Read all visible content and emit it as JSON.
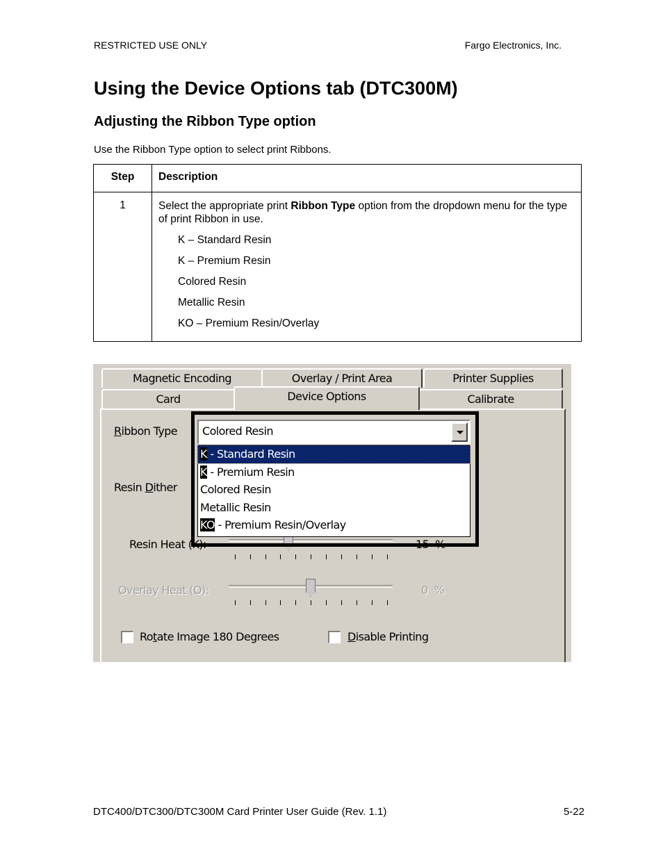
{
  "header": {
    "left": "RESTRICTED USE ONLY",
    "right": "Fargo Electronics, Inc."
  },
  "title": "Using the Device Options tab (DTC300M)",
  "subtitle": "Adjusting the Ribbon Type option",
  "intro": "Use the Ribbon Type option to select print Ribbons.",
  "table": {
    "headers": [
      "Step",
      "Description"
    ],
    "rows": [
      {
        "step": "1",
        "text_before": "Select the appropriate print ",
        "text_bold": "Ribbon Type",
        "text_after": " option from the dropdown menu for the type of print Ribbon in use.",
        "options": [
          "K – Standard Resin",
          "K – Premium Resin",
          "Colored Resin",
          "Metallic Resin",
          "KO – Premium Resin/Overlay"
        ]
      }
    ]
  },
  "dialog": {
    "tabs_back": [
      "Magnetic Encoding",
      "Overlay / Print Area",
      "Printer Supplies"
    ],
    "tabs_front": [
      "Card",
      "Device Options",
      "Calibrate"
    ],
    "active_tab": "Device Options",
    "ribbon_type": {
      "label_hotkey": "R",
      "label_rest": "ibbon Type",
      "value": "Colored Resin",
      "options": [
        {
          "hotkey": "K",
          "rest": " - Standard Resin",
          "selected": true
        },
        {
          "hotkey": "K",
          "rest": " - Premium Resin",
          "selected": false
        },
        {
          "hotkey": "",
          "rest": "Colored Resin",
          "selected": false
        },
        {
          "hotkey": "",
          "rest": "Metallic Resin",
          "selected": false
        },
        {
          "hotkey": "KO",
          "rest": " - Premium Resin/Overlay",
          "selected": false
        }
      ]
    },
    "resin_dither": {
      "label_pre": "Resin ",
      "label_hotkey": "D",
      "label_rest": "ither"
    },
    "resin_heat": {
      "label": "Resin Heat (K):",
      "value": "15",
      "unit": "%",
      "position": 0.4
    },
    "overlay_heat": {
      "label": "Overlay Heat (O):",
      "value": "0",
      "unit": "%",
      "position": 0.5,
      "disabled": true
    },
    "rotate": {
      "label_pre": "Ro",
      "label_hotkey": "t",
      "label_rest": "ate Image 180 Degrees",
      "checked": false
    },
    "disable_printing": {
      "label_hotkey": "D",
      "label_rest": "isable Printing",
      "checked": false
    }
  },
  "footer": {
    "left": "DTC400/DTC300/DTC300M Card Printer User Guide (Rev. 1.1)",
    "right": "5-22"
  }
}
